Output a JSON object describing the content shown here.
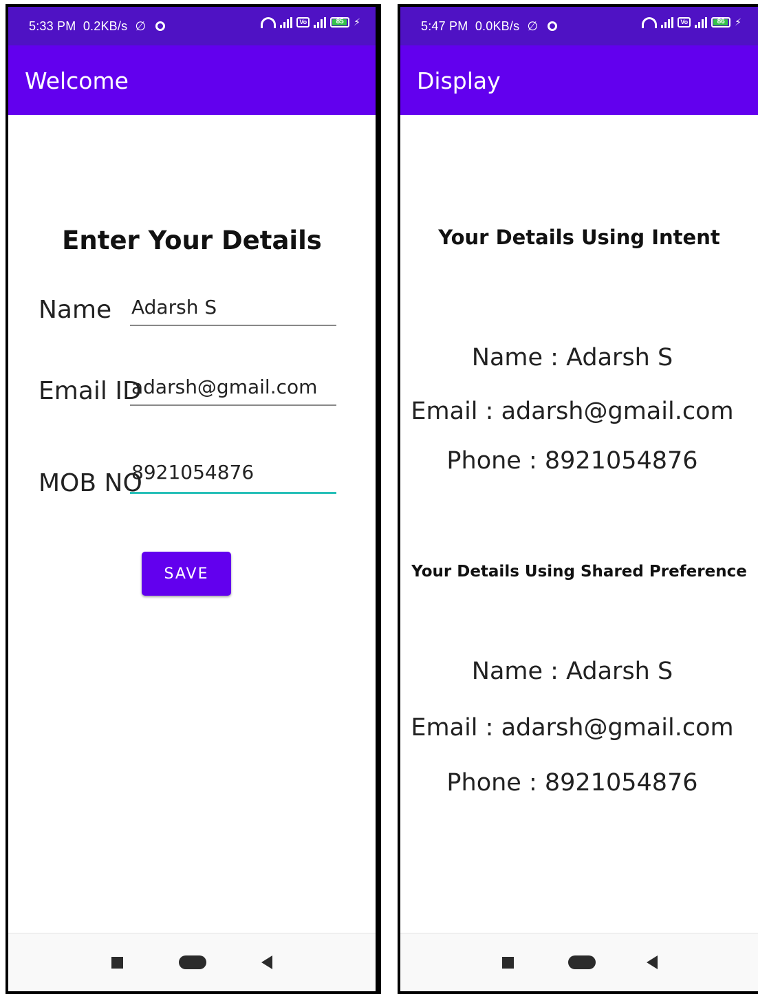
{
  "left": {
    "status": {
      "time": "5:33 PM",
      "speed": "0.2KB/s",
      "battery": "85"
    },
    "appbar_title": "Welcome",
    "heading": "Enter Your Details",
    "fields": [
      {
        "label": "Name",
        "value": "Adarsh S"
      },
      {
        "label": "Email ID",
        "value": "adarsh@gmail.com"
      },
      {
        "label": "MOB NO",
        "value": "8921054876"
      }
    ],
    "save_label": "SAVE"
  },
  "right": {
    "status": {
      "time": "5:47 PM",
      "speed": "0.0KB/s",
      "battery": "86"
    },
    "appbar_title": "Display",
    "intent_heading": "Your Details Using Intent",
    "intent_lines": [
      "Name : Adarsh S",
      "Email : adarsh@gmail.com",
      "Phone : 8921054876"
    ],
    "shared_heading": "Your Details Using Shared Preference",
    "shared_lines": [
      "Name : Adarsh S",
      "Email : adarsh@gmail.com",
      "Phone : 8921054876"
    ]
  },
  "colors": {
    "statusbar": "#4f12c4",
    "appbar": "#6200ee",
    "button": "#6200ee",
    "focus_underline": "#26bfb8"
  },
  "icons": [
    "silent-bell-icon",
    "gear-icon",
    "wifi-icon",
    "signal-icon",
    "volte-icon",
    "battery-icon",
    "charging-bolt-icon",
    "recent-apps-icon",
    "home-icon",
    "back-icon"
  ]
}
